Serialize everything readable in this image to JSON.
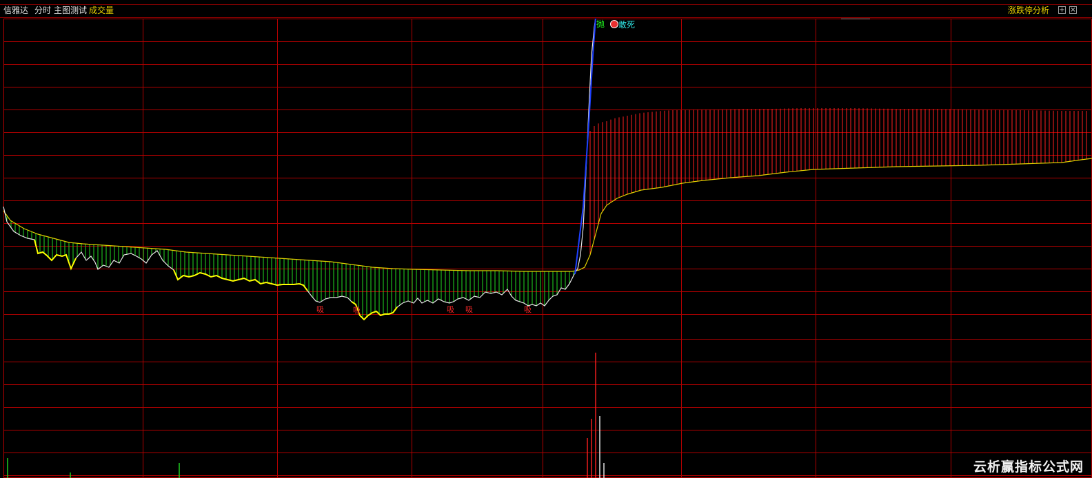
{
  "toolbar": {
    "app_name": "信雅达",
    "mode": "分时",
    "indicator": "主图测试",
    "volume_label": "成交量",
    "right_label": "涨跌停分析",
    "btn_add": "+",
    "btn_close": "×"
  },
  "chart_data": {
    "type": "line",
    "grid": true,
    "colors": {
      "background": "#000000",
      "grid": "#b30000",
      "price_line": "#e6e6e6",
      "avg_line": "#e0d000",
      "buy_zone": "#ffff00",
      "up_bar": "#ff2020",
      "down_bar": "#22dd22",
      "limit_line": "#1e40ff"
    },
    "annotations": {
      "sell_label": "抛",
      "dead_label": "敢死",
      "buy_label": "吸"
    },
    "volume_bars_visible": true
  },
  "watermark": "云析赢指标公式网"
}
